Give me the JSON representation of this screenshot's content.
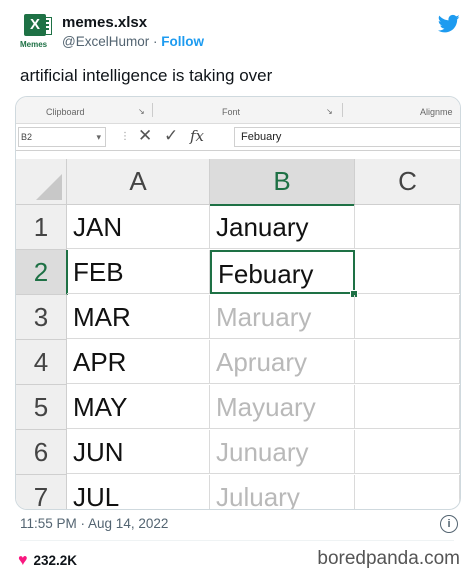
{
  "tweet": {
    "account_name": "memes.xlsx",
    "handle": "@ExcelHumor",
    "separator": " · ",
    "follow_label": "Follow",
    "avatar_label": "Memes",
    "avatar_letter": "X",
    "text": "artificial intelligence is taking over",
    "timestamp": "11:55 PM · Aug 14, 2022",
    "likes": "232.2K",
    "info_glyph": "i",
    "heart_glyph": "♥"
  },
  "watermark": "boredpanda.com",
  "excel": {
    "ribbon": {
      "clipboard": "Clipboard",
      "font": "Font",
      "alignment": "Alignme"
    },
    "name_box": "B2",
    "formula_value": "Febuary",
    "formula_buttons": {
      "cancel": "✕",
      "enter": "✓",
      "fx": "fx"
    },
    "columns": [
      "A",
      "B",
      "C"
    ],
    "selected_column": "B",
    "rows": [
      {
        "num": "1",
        "a": "JAN",
        "b": "January",
        "b_ghost": false
      },
      {
        "num": "2",
        "a": "FEB",
        "b": "Febuary",
        "b_ghost": false,
        "active": true
      },
      {
        "num": "3",
        "a": "MAR",
        "b": "Maruary",
        "b_ghost": true
      },
      {
        "num": "4",
        "a": "APR",
        "b": "Apruary",
        "b_ghost": true
      },
      {
        "num": "5",
        "a": "MAY",
        "b": "Mayuary",
        "b_ghost": true
      },
      {
        "num": "6",
        "a": "JUN",
        "b": "Junuary",
        "b_ghost": true
      },
      {
        "num": "7",
        "a": "JUL",
        "b": "Juluary",
        "b_ghost": true
      }
    ],
    "colors": {
      "excel_green": "#1e7145",
      "twitter_blue": "#1d9bf0",
      "like_pink": "#f91880"
    }
  }
}
